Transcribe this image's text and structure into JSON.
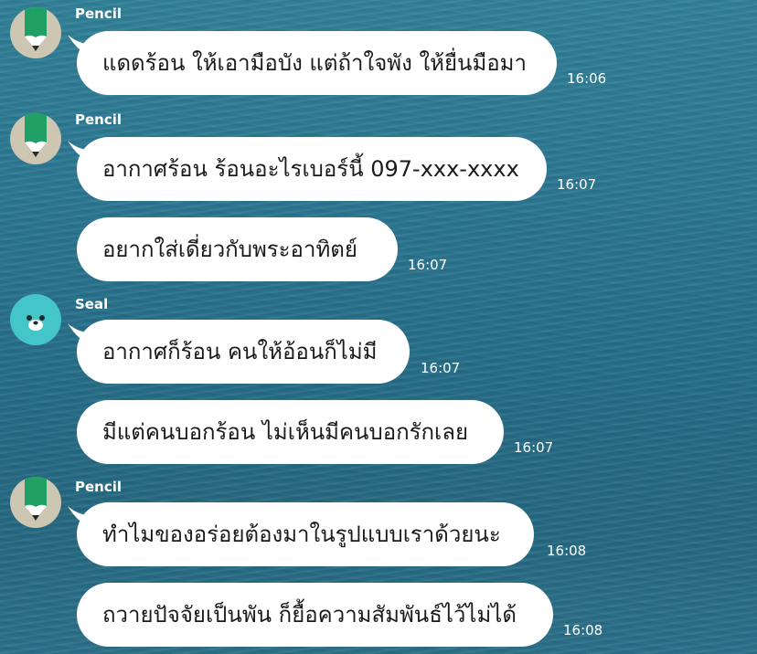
{
  "messages": [
    {
      "sender": "Pencil",
      "text": "แดดร้อน ให้เอามือบัง แต่ถ้าใจพัง ให้ยื่นมือมา",
      "time": "16:06"
    },
    {
      "sender": "Pencil",
      "text": "อากาศร้อน ร้อนอะไรเบอร์นี้ 097-xxx-xxxx",
      "time": "16:07"
    },
    {
      "text": "อยากใส่เดี่ยวกับพระอาทิตย์",
      "time": "16:07"
    },
    {
      "sender": "Seal",
      "text": "อากาศก็ร้อน คนให้อ้อนก็ไม่มี",
      "time": "16:07"
    },
    {
      "text": "มีแต่คนบอกร้อน ไม่เห็นมีคนบอกรักเลย",
      "time": "16:07"
    },
    {
      "sender": "Pencil",
      "text": "ทำไมของอร่อยต้องมาในรูปแบบเราด้วยนะ",
      "time": "16:08"
    },
    {
      "text": "ถวายปัจจัยเป็นพัน ก็ยื้อความสัมพันธ์ไว้ไม่ได้",
      "time": "16:08"
    }
  ],
  "colors": {
    "background": "#2a7590",
    "bubble": "#ffffff",
    "text": "#1b1b1b",
    "pencil_green": "#20a064",
    "pencil_avatar_bg": "#cdc6b3",
    "seal_avatar_bg": "#44c6c8"
  },
  "icons": {
    "pencil_avatar": "pencil-character-icon",
    "seal_avatar": "seal-character-icon"
  }
}
